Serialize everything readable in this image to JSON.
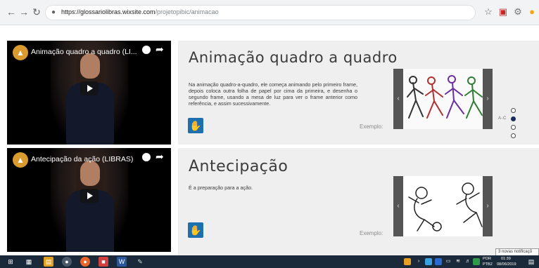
{
  "browser": {
    "url_host": "https://glossariolibras.wixsite.com",
    "url_path": "/projetopibic/animacao"
  },
  "sections": [
    {
      "video_title": "Animação quadro a quadro (LI...",
      "heading": "Animação quadro a quadro",
      "description": "Na animação quadro-a-quadro, ele começa animando pelo primeiro frame, depois coloca outra folha de papel por cima da primeira, e desenha o segundo frame, usando a mesa de luz para ver o frame anterior como referência, e assim sucessivamente.",
      "example_label": "Exemplo:"
    },
    {
      "video_title": "Antecipação da ação (LIBRAS)",
      "heading": "Antecipação",
      "description": "É a preparação para a ação.",
      "example_label": "Exemplo:"
    }
  ],
  "side_nav": {
    "label": "A-C"
  },
  "notification": {
    "text": "3 novas notificaçõ"
  },
  "taskbar": {
    "language": "POR",
    "layout": "PTB2",
    "time": "01:39",
    "date": "08/06/2019"
  },
  "colors": {
    "panel_bg": "#efefef",
    "libras_blue": "#1d6fae",
    "taskbar": "#1b2a3a",
    "nav_dot_active": "#1a2a5a"
  },
  "icons": {
    "back": "arrow-left",
    "forward": "arrow-right",
    "reload": "reload",
    "lock": "lock",
    "star": "star",
    "share": "share-arrow",
    "watch_later": "clock",
    "play": "play",
    "libras": "sign-language-hands"
  }
}
